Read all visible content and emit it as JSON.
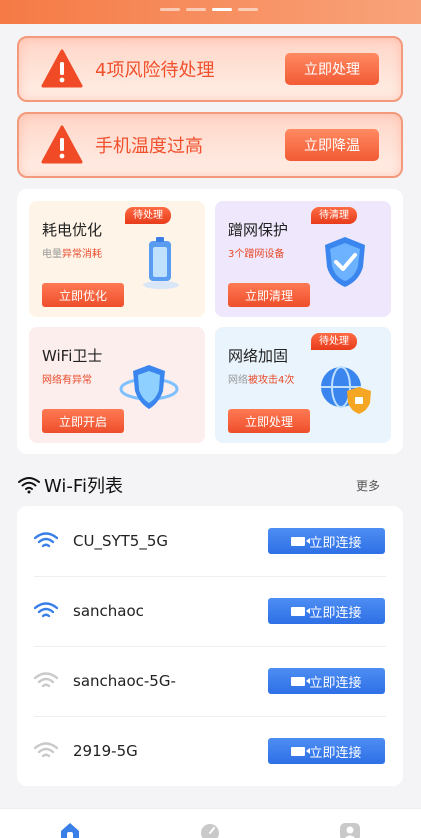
{
  "alerts": [
    {
      "text": "4项风险待处理",
      "button": "立即处理"
    },
    {
      "text": "手机温度过高",
      "button": "立即降温"
    }
  ],
  "tools": [
    {
      "title": "耗电优化",
      "sub_prefix": "电量",
      "sub": "异常消耗",
      "button": "立即优化",
      "badge": "待处理",
      "bg": "#fff4e8"
    },
    {
      "title": "蹭网保护",
      "sub_prefix": "",
      "sub": "3个蹭网设备",
      "button": "立即清理",
      "badge": "待清理",
      "bg": "#efe8fc"
    },
    {
      "title": "WiFi卫士",
      "sub_prefix": "",
      "sub": "网络有异常",
      "button": "立即开启",
      "badge": "",
      "bg": "#fdeeee"
    },
    {
      "title": "网络加固",
      "sub_prefix": "网络",
      "sub": "被攻击4次",
      "button": "立即处理",
      "badge": "待处理",
      "bg": "#eaf4fc"
    }
  ],
  "wifi": {
    "title": "Wi-Fi列表",
    "more": "更多",
    "networks": [
      {
        "name": "CU_SYT5_5G",
        "button": "立即连接",
        "strong": true
      },
      {
        "name": "sanchaoc",
        "button": "立即连接",
        "strong": true
      },
      {
        "name": "sanchaoc-5G-",
        "button": "立即连接",
        "strong": false
      },
      {
        "name": "2919-5G",
        "button": "立即连接",
        "strong": false
      }
    ]
  },
  "colors": {
    "accent": "#f0502c",
    "wifi_strong": "#3a7ee8",
    "wifi_weak": "#c9c9c9",
    "connect_btn": "#3a7ee8"
  }
}
